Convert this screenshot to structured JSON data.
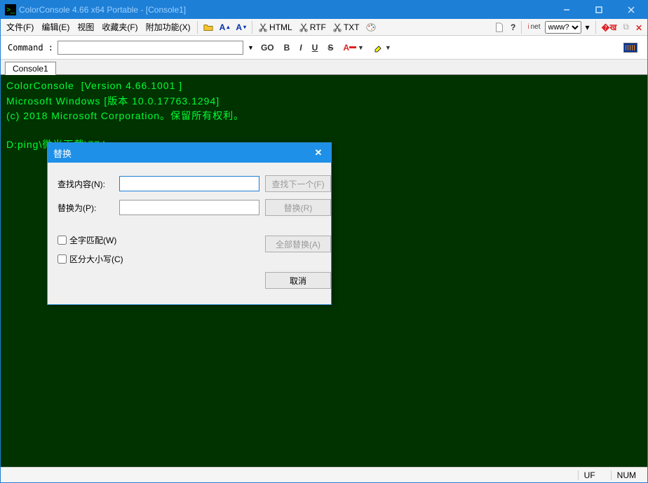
{
  "titlebar": {
    "icon_glyph": ">_",
    "title": "ColorConsole 4.66 x64 Portable - [Console1]"
  },
  "menu": {
    "file": "文件(F)",
    "edit": "编辑(E)",
    "view": "视图",
    "fav": "收藏夹(F)",
    "extra": "附加功能(X)",
    "html": "HTML",
    "rtf": "RTF",
    "txt": "TXT",
    "www_label": "www?",
    "www_options": [
      "www?"
    ]
  },
  "toolbar2": {
    "command_label": "Command :",
    "go": "GO"
  },
  "tab": {
    "label": "Console1"
  },
  "console": {
    "line1": "ColorConsole  [Version 4.66.1001 ]",
    "line2": "Microsoft Windows [版本 10.0.17763.1294]",
    "line3": "(c) 2018 Microsoft Corporation。保留所有权利。",
    "prompt": "D:ping\\微当下载\\774>"
  },
  "dialog": {
    "title": "替换",
    "find_label": "查找内容(N):",
    "replace_label": "替换为(P):",
    "find_value": "",
    "replace_value": "",
    "find_next": "查找下一个(F)",
    "replace_btn": "替换(R)",
    "replace_all": "全部替换(A)",
    "cancel": "取消",
    "whole_word": "全字匹配(W)",
    "match_case": "区分大小写(C)"
  },
  "status": {
    "uf": "UF",
    "num": "NUM"
  }
}
